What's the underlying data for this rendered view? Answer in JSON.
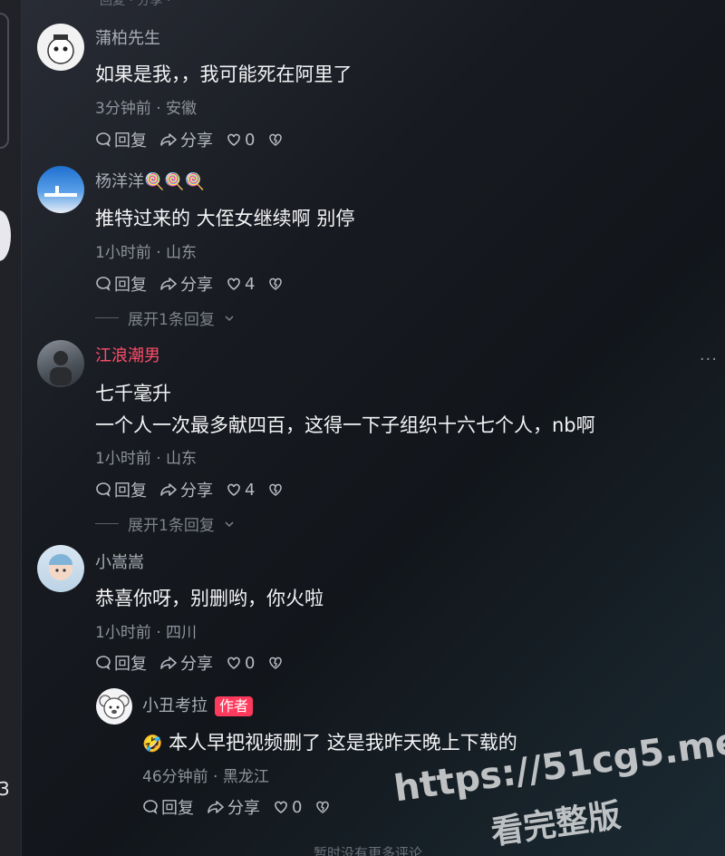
{
  "top_faint": "回复  ·  分享  ·",
  "comments": [
    {
      "username": "蒲柏先生",
      "lines": [
        "如果是我，，我可能死在阿里了"
      ],
      "meta": "3分钟前 · 安徽",
      "reply": "回复",
      "share": "分享",
      "likes": "0"
    },
    {
      "username": "杨洋洋🍭🍭🍭",
      "lines": [
        "推特过来的 大侄女继续啊 别停"
      ],
      "meta": "1小时前 · 山东",
      "reply": "回复",
      "share": "分享",
      "likes": "4",
      "expand": "展开1条回复"
    },
    {
      "username": "江浪潮男",
      "lines": [
        "七千毫升",
        "一个人一次最多献四百，这得一下子组织十六七个人，nb啊"
      ],
      "meta": "1小时前 · 山东",
      "reply": "回复",
      "share": "分享",
      "likes": "4",
      "expand": "展开1条回复"
    },
    {
      "username": "小嵩嵩",
      "lines": [
        "恭喜你呀，别删哟，你火啦"
      ],
      "meta": "1小时前 · 四川",
      "reply": "回复",
      "share": "分享",
      "likes": "0"
    }
  ],
  "reply": {
    "username": "小丑考拉",
    "badge": "作者",
    "emoji": "🤣",
    "text": "本人早把视频删了 这是我昨天晚上下载的",
    "meta": "46分钟前 · 黑龙江",
    "reply": "回复",
    "share": "分享",
    "likes": "0"
  },
  "left_digit": "3",
  "more_dots": "···",
  "watermark": {
    "line1": "https://51cg5.me",
    "line2": "看完整版"
  },
  "footer": "暂时没有更多评论",
  "colors": {
    "author_red": "#ff4d6a",
    "badge_red": "#ff3a5c"
  }
}
